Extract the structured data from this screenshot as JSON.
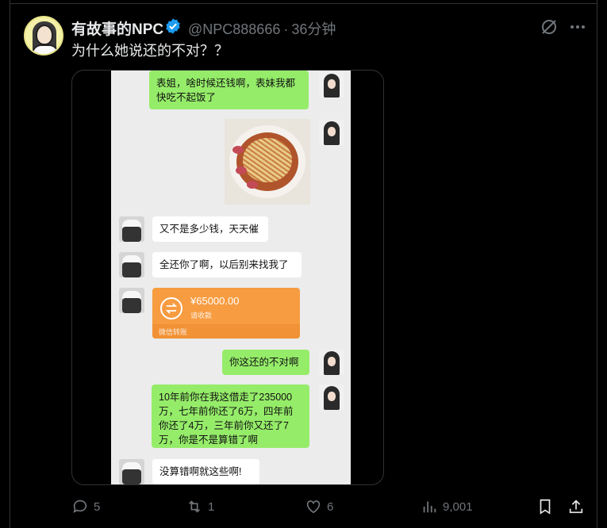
{
  "post": {
    "author_name": "有故事的NPC",
    "handle": "@NPC888666",
    "separator": "·",
    "time": "36分钟",
    "text": "为什么她说还的不对？？"
  },
  "chat": {
    "msg1": "表姐，啥时候还钱啊，表妹我都快吃不起饭了",
    "msg2": "又不是多少钱，天天催",
    "msg3": "全还你了啊，以后别来找我了",
    "transfer_amount": "¥65000.00",
    "transfer_status": "请收款",
    "transfer_label": "微信转账",
    "msg4": "你这还的不对啊",
    "msg5": "10年前你在我这借走了235000万，七年前你还了6万，四年前你还了4万，三年前你又还了7万，你是不是算错了啊",
    "msg6": "没算错啊就这些啊!"
  },
  "actions": {
    "replies": "5",
    "reposts": "1",
    "likes": "6",
    "views": "9,001"
  },
  "icons": [
    "verified-badge-icon",
    "grok-icon",
    "more-icon",
    "reply-icon",
    "repost-icon",
    "like-icon",
    "views-icon",
    "bookmark-icon",
    "share-icon",
    "transfer-icon"
  ],
  "colors": {
    "accent": "#1d9bf0",
    "wechat_green": "#95ec69",
    "transfer_orange": "#f79c41"
  }
}
